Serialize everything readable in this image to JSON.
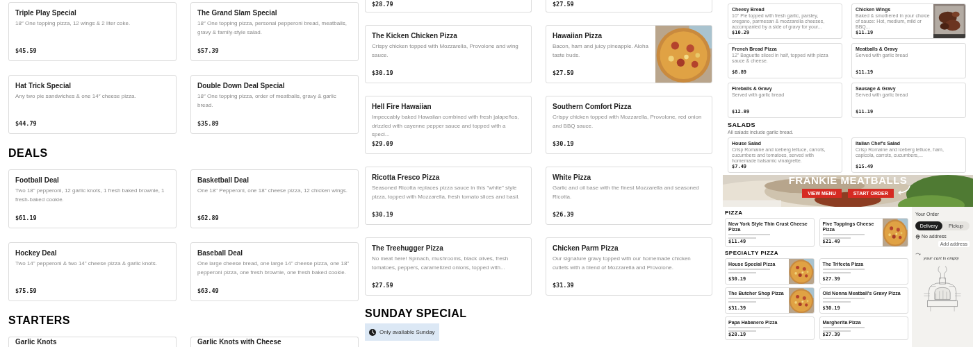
{
  "left_page": {
    "sections": [
      {
        "items": [
          {
            "name": "Triple Play Special",
            "description": "18″ One topping pizza, 12 wings & 2 liter coke.",
            "price": "$45.59"
          },
          {
            "name": "The Grand Slam Special",
            "description": "18″ One topping pizza, personal pepperoni bread, meatballs, gravy & family-style salad.",
            "price": "$57.39"
          },
          {
            "name": "Hat Trick Special",
            "description": "Any two pie sandwiches & one 14″ cheese pizza.",
            "price": "$44.79"
          },
          {
            "name": "Double Down Deal Special",
            "description": "18″ One topping pizza, order of meatballs, gravy & garlic bread.",
            "price": "$35.89"
          }
        ]
      },
      {
        "heading": "DEALS",
        "items": [
          {
            "name": "Football Deal",
            "description": "Two 18\" pepperoni, 12 garlic knots, 1 fresh baked brownie, 1 fresh-baked cookie.",
            "price": "$61.19"
          },
          {
            "name": "Basketball Deal",
            "description": "One 18\" Pepperoni, one 18\" cheese pizza, 12 chicken wings.",
            "price": "$62.89"
          },
          {
            "name": "Hockey Deal",
            "description": "Two 14\" pepperoni & two 14\" cheese pizza & garlic knots.",
            "price": "$75.59"
          },
          {
            "name": "Baseball Deal",
            "description": "One large cheese bread, one large 14\" cheese pizza, one 18\" pepperoni pizza, one fresh brownie, one fresh baked cookie.",
            "price": "$63.49"
          }
        ]
      },
      {
        "heading": "STARTERS",
        "items": [
          {
            "name": "Garlic Knots"
          },
          {
            "name": "Garlic Knots with Cheese"
          }
        ]
      }
    ]
  },
  "middle_page": {
    "sections": [
      {
        "items": [
          {
            "price": "$28.79"
          },
          {
            "price": "$27.59"
          },
          {
            "name": "The Kicken Chicken Pizza",
            "description": "Crispy chicken topped with Mozzarella, Provolone and wing sauce.",
            "price": "$30.19"
          },
          {
            "name": "Hawaiian Pizza",
            "description": "Bacon, ham and juicy pineapple. Aloha taste buds.",
            "price": "$27.59",
            "kind": "picture"
          },
          {
            "name": "Hell Fire Hawaiian",
            "description": "Impeccably baked Hawaiian combined with fresh jalapeños, drizzled with cayenne pepper sauce and topped with a speci...",
            "price": "$29.09"
          },
          {
            "name": "Southern Comfort Pizza",
            "description": "Crispy chicken topped with Mozzarella, Provolone, red onion and BBQ sauce.",
            "price": "$30.19"
          },
          {
            "name": "Ricotta Fresco Pizza",
            "description": "Seasoned Ricotta replaces pizza sauce in this \"white\" style pizza, topped with Mozzarella, fresh tomato slices and basil.",
            "price": "$30.19"
          },
          {
            "name": "White Pizza",
            "description": "Garlic and oil base with the finest Mozzarella and seasoned Ricotta.",
            "price": "$26.39"
          },
          {
            "name": "The Treehugger Pizza",
            "description": "No meat here! Spinach, mushrooms, black olives, fresh tomatoes, peppers, caramelized onions, topped with...",
            "price": "$27.59"
          },
          {
            "name": "Chicken Parm Pizza",
            "description": "Our signature gravy topped with our homemade chicken cutlets with a blend of Mozzarella and Provolone.",
            "price": "$31.39"
          }
        ]
      },
      {
        "heading": "SUNDAY SPECIAL",
        "notice": "Only available Sunday"
      }
    ]
  },
  "thumbnail_menu": {
    "sections": [
      {
        "items": [
          {
            "name": "Cheesy Bread",
            "description": "10\" Pie topped with fresh garlic, parsley, oregano, parmesan & mozzarella cheeses, accompanied by a side of gravy for your...",
            "price": "$10.29"
          },
          {
            "name": "Chicken Wings",
            "description": "Baked & smothered in your choice of sauce: Hot, medium, mild or BBQ...",
            "price": "$11.19",
            "kind": "picture"
          },
          {
            "name": "French Bread Pizza",
            "description": "12\" Baguette sliced in half, topped with pizza sauce & cheese.",
            "price": "$8.89"
          },
          {
            "name": "Meatballs & Gravy",
            "description": "Served with garlic bread",
            "price": "$11.19"
          },
          {
            "name": "Fireballs & Gravy",
            "description": "Served with garlic bread",
            "price": "$12.89"
          },
          {
            "name": "Sausage & Gravy",
            "description": "Served with garlic bread",
            "price": "$11.19"
          }
        ]
      },
      {
        "heading": "SALADS",
        "subtitle": "All salads include garlic bread.",
        "items": [
          {
            "name": "House Salad",
            "description": "Crisp Romaine and iceberg lettuce, carrots, cucumbers and tomatoes, served with homemade balsamic vinaigrette.",
            "price": "$7.49"
          },
          {
            "name": "Italian Chef's Salad",
            "description": "Crisp Romaine and iceberg lettuce, ham, capicola, carrots, cucumbers,...",
            "price": "$15.49"
          }
        ]
      }
    ]
  },
  "thumbnail_order_page": {
    "hero": {
      "title": "FRANKIE MEATBALLS",
      "buttons": [
        "VIEW MENU",
        "START ORDER"
      ]
    },
    "sections": [
      {
        "heading": "PIZZA",
        "items": [
          {
            "name": "New York Style Thin Crust Cheese Pizza",
            "price": "$11.49"
          },
          {
            "name": "Five Toppings Cheese Pizza",
            "price": "$21.49",
            "kind": "picture"
          }
        ]
      },
      {
        "heading": "SPECIALTY PIZZA",
        "items": [
          {
            "name": "House Special Pizza",
            "price": "$30.19",
            "kind": "picture"
          },
          {
            "name": "The Trifecta Pizza",
            "price": "$27.39"
          },
          {
            "name": "The Butcher Shop Pizza",
            "price": "$31.39",
            "kind": "picture"
          },
          {
            "name": "Old Nonna Meatball's Gravy Pizza",
            "price": "$30.19"
          },
          {
            "name": "Papa Habanero Pizza",
            "price": "$28.19"
          },
          {
            "name": "Margherita Pizza",
            "price": "$27.39"
          }
        ]
      }
    ],
    "order": {
      "title": "Your Order",
      "modes": [
        {
          "label": "Delivery",
          "selected": true
        },
        {
          "label": "Pickup",
          "selected": false
        }
      ],
      "address": "No address",
      "address_action": "Add address",
      "empty_message": "your cart is empty"
    }
  }
}
